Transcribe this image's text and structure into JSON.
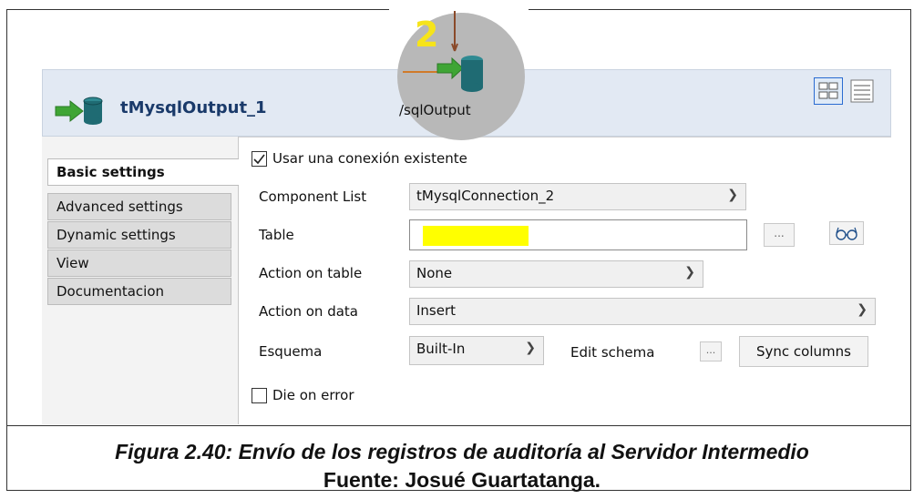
{
  "header": {
    "title": "tMysqlOutput_1"
  },
  "overlay": {
    "step_number": "2",
    "label": "/sqlOutput"
  },
  "tabs": [
    {
      "label": "Basic settings",
      "active": true
    },
    {
      "label": "Advanced settings",
      "active": false
    },
    {
      "label": "Dynamic settings",
      "active": false
    },
    {
      "label": "View",
      "active": false
    },
    {
      "label": "Documentacion",
      "active": false
    }
  ],
  "form": {
    "use_existing_connection": {
      "label": "Usar una conexión existente",
      "checked": true
    },
    "component_list": {
      "label": "Component List",
      "value": "tMysqlConnection_2"
    },
    "table": {
      "label": "Table",
      "value": "",
      "browse_label": "..."
    },
    "action_on_table": {
      "label": "Action on table",
      "value": "None"
    },
    "action_on_data": {
      "label": "Action on data",
      "value": "Insert"
    },
    "schema": {
      "label": "Esquema",
      "value": "Built-In",
      "edit_label": "Edit schema",
      "edit_button": "...",
      "sync_button": "Sync columns"
    },
    "die_on_error": {
      "label": "Die on error",
      "checked": false
    }
  },
  "caption": {
    "line1": "Figura 2.40: Envío de los registros de auditoría al Servidor Intermedio",
    "line2": "Fuente: Josué Guartatanga."
  },
  "colors": {
    "accent": "#2a6bd1",
    "highlight": "#ffff00",
    "icon_green": "#3fa535",
    "icon_teal": "#1f6b73"
  }
}
